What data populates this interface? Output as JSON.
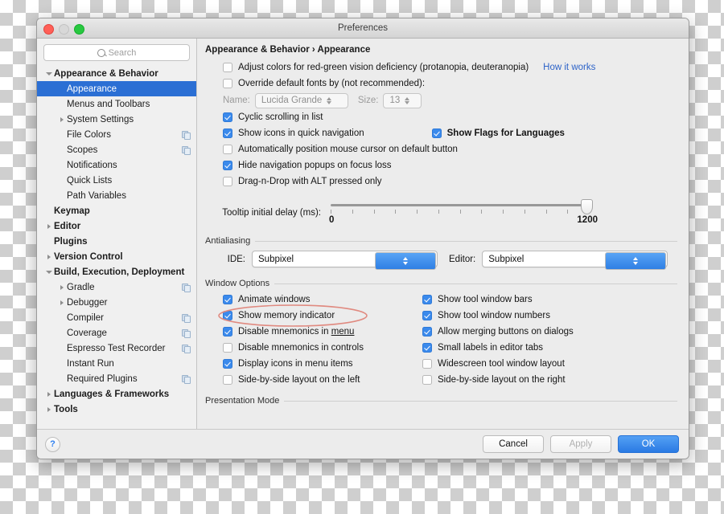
{
  "window": {
    "title": "Preferences",
    "traffic_lights": [
      "close-button",
      "minimize-button",
      "zoom-button"
    ]
  },
  "sidebar": {
    "search": {
      "placeholder": "Search",
      "value": ""
    },
    "items": [
      {
        "label": "Appearance & Behavior",
        "level": 0,
        "bold": true,
        "twisty": "open",
        "selected": false,
        "copy": false
      },
      {
        "label": "Appearance",
        "level": 1,
        "bold": false,
        "twisty": "none",
        "selected": true,
        "copy": false
      },
      {
        "label": "Menus and Toolbars",
        "level": 1,
        "bold": false,
        "twisty": "none",
        "selected": false,
        "copy": false
      },
      {
        "label": "System Settings",
        "level": 1,
        "bold": false,
        "twisty": "closed",
        "selected": false,
        "copy": false
      },
      {
        "label": "File Colors",
        "level": 1,
        "bold": false,
        "twisty": "none",
        "selected": false,
        "copy": true
      },
      {
        "label": "Scopes",
        "level": 1,
        "bold": false,
        "twisty": "none",
        "selected": false,
        "copy": true
      },
      {
        "label": "Notifications",
        "level": 1,
        "bold": false,
        "twisty": "none",
        "selected": false,
        "copy": false
      },
      {
        "label": "Quick Lists",
        "level": 1,
        "bold": false,
        "twisty": "none",
        "selected": false,
        "copy": false
      },
      {
        "label": "Path Variables",
        "level": 1,
        "bold": false,
        "twisty": "none",
        "selected": false,
        "copy": false
      },
      {
        "label": "Keymap",
        "level": 0,
        "bold": true,
        "twisty": "none",
        "selected": false,
        "copy": false
      },
      {
        "label": "Editor",
        "level": 0,
        "bold": true,
        "twisty": "closed",
        "selected": false,
        "copy": false
      },
      {
        "label": "Plugins",
        "level": 0,
        "bold": true,
        "twisty": "none",
        "selected": false,
        "copy": false
      },
      {
        "label": "Version Control",
        "level": 0,
        "bold": true,
        "twisty": "closed",
        "selected": false,
        "copy": false
      },
      {
        "label": "Build, Execution, Deployment",
        "level": 0,
        "bold": true,
        "twisty": "open",
        "selected": false,
        "copy": false
      },
      {
        "label": "Gradle",
        "level": 1,
        "bold": false,
        "twisty": "closed",
        "selected": false,
        "copy": true
      },
      {
        "label": "Debugger",
        "level": 1,
        "bold": false,
        "twisty": "closed",
        "selected": false,
        "copy": false
      },
      {
        "label": "Compiler",
        "level": 1,
        "bold": false,
        "twisty": "none",
        "selected": false,
        "copy": true
      },
      {
        "label": "Coverage",
        "level": 1,
        "bold": false,
        "twisty": "none",
        "selected": false,
        "copy": true
      },
      {
        "label": "Espresso Test Recorder",
        "level": 1,
        "bold": false,
        "twisty": "none",
        "selected": false,
        "copy": true
      },
      {
        "label": "Instant Run",
        "level": 1,
        "bold": false,
        "twisty": "none",
        "selected": false,
        "copy": false
      },
      {
        "label": "Required Plugins",
        "level": 1,
        "bold": false,
        "twisty": "none",
        "selected": false,
        "copy": true
      },
      {
        "label": "Languages & Frameworks",
        "level": 0,
        "bold": true,
        "twisty": "closed",
        "selected": false,
        "copy": false
      },
      {
        "label": "Tools",
        "level": 0,
        "bold": true,
        "twisty": "closed",
        "selected": false,
        "copy": false
      }
    ]
  },
  "main": {
    "breadcrumb": "Appearance & Behavior › Appearance",
    "color_deficiency": {
      "label": "Adjust colors for red-green vision deficiency (protanopia, deuteranopia)",
      "checked": false
    },
    "how_it_works_link": "How it works",
    "override_fonts": {
      "label": "Override default fonts by (not recommended):",
      "checked": false
    },
    "font_name": {
      "label": "Name:",
      "value": "Lucida Grande"
    },
    "font_size": {
      "label": "Size:",
      "value": "13"
    },
    "options": [
      {
        "label": "Cyclic scrolling in list",
        "checked": true
      },
      {
        "label": "Show icons in quick navigation",
        "checked": true
      },
      {
        "label": "Automatically position mouse cursor on default button",
        "checked": false
      },
      {
        "label": "Hide navigation popups on focus loss",
        "checked": true
      },
      {
        "label": "Drag-n-Drop with ALT pressed only",
        "checked": false
      }
    ],
    "show_flags": {
      "label": "Show Flags for Languages",
      "checked": true
    },
    "tooltip_delay": {
      "label": "Tooltip initial delay (ms):",
      "min": "0",
      "max": "1200",
      "value": 1200,
      "tick_count": 13
    },
    "antialiasing": {
      "section_title": "Antialiasing",
      "ide_label": "IDE:",
      "ide_value": "Subpixel",
      "editor_label": "Editor:",
      "editor_value": "Subpixel"
    },
    "window_options": {
      "section_title": "Window Options",
      "left": [
        {
          "label": "Animate windows",
          "checked": true
        },
        {
          "label": "Show memory indicator",
          "checked": true,
          "annotated": true
        },
        {
          "label": "Disable mnemonics in menu",
          "checked": true,
          "underline": "menu"
        },
        {
          "label": "Disable mnemonics in controls",
          "checked": false
        },
        {
          "label": "Display icons in menu items",
          "checked": true
        },
        {
          "label": "Side-by-side layout on the left",
          "checked": false
        }
      ],
      "right": [
        {
          "label": "Show tool window bars",
          "checked": true
        },
        {
          "label": "Show tool window numbers",
          "checked": true
        },
        {
          "label": "Allow merging buttons on dialogs",
          "checked": true
        },
        {
          "label": "Small labels in editor tabs",
          "checked": true
        },
        {
          "label": "Widescreen tool window layout",
          "checked": false
        },
        {
          "label": "Side-by-side layout on the right",
          "checked": false
        }
      ]
    },
    "presentation_mode": {
      "section_title": "Presentation Mode"
    }
  },
  "footer": {
    "help_label": "?",
    "cancel_label": "Cancel",
    "apply_label": "Apply",
    "ok_label": "OK"
  },
  "annotation": {
    "shape": "ellipse",
    "color": "#e08a80"
  },
  "colors": {
    "selection_blue": "#2b6fd4",
    "checkbox_blue": "#3b8aec",
    "link_blue": "#2d63c8",
    "primary_button": "#2a7ae3",
    "annotation_red": "#e08a80"
  }
}
